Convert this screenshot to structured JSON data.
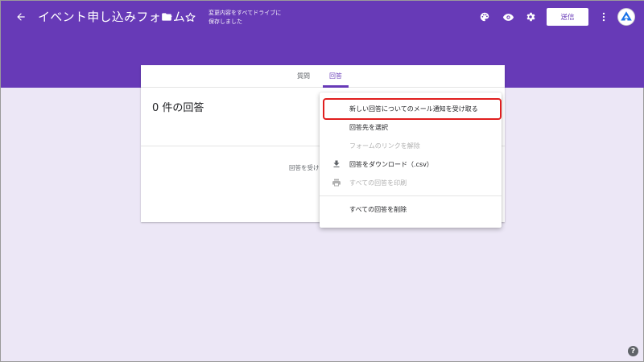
{
  "header": {
    "title": "イベント申し込みフォーム",
    "save_status_line1": "変更内容をすべてドライブに",
    "save_status_line2": "保存しました",
    "send_label": "送信",
    "icons": [
      "back-arrow-icon",
      "folder-icon",
      "star-icon",
      "palette-icon",
      "eye-icon",
      "gear-icon",
      "more-vert-icon"
    ],
    "color": "#673ab7"
  },
  "tabs": [
    {
      "label": "質問",
      "active": false
    },
    {
      "label": "回答",
      "active": true
    }
  ],
  "responses": {
    "count_label": "0 件の回答",
    "accepting_label": "回答を受け"
  },
  "menu": {
    "items": [
      {
        "label": "新しい回答についてのメール通知を受け取る",
        "disabled": false,
        "icon": "",
        "highlighted": true
      },
      {
        "label": "回答先を選択",
        "disabled": false,
        "icon": ""
      },
      {
        "label": "フォームのリンクを解除",
        "disabled": true,
        "icon": ""
      },
      {
        "label": "回答をダウンロード（.csv）",
        "disabled": false,
        "icon": "download-icon"
      },
      {
        "label": "すべての回答を印刷",
        "disabled": true,
        "icon": "print-icon"
      },
      {
        "label": "すべての回答を削除",
        "disabled": false,
        "icon": ""
      }
    ]
  },
  "highlight_color": "#e01e1e",
  "help": {
    "label": "?"
  }
}
